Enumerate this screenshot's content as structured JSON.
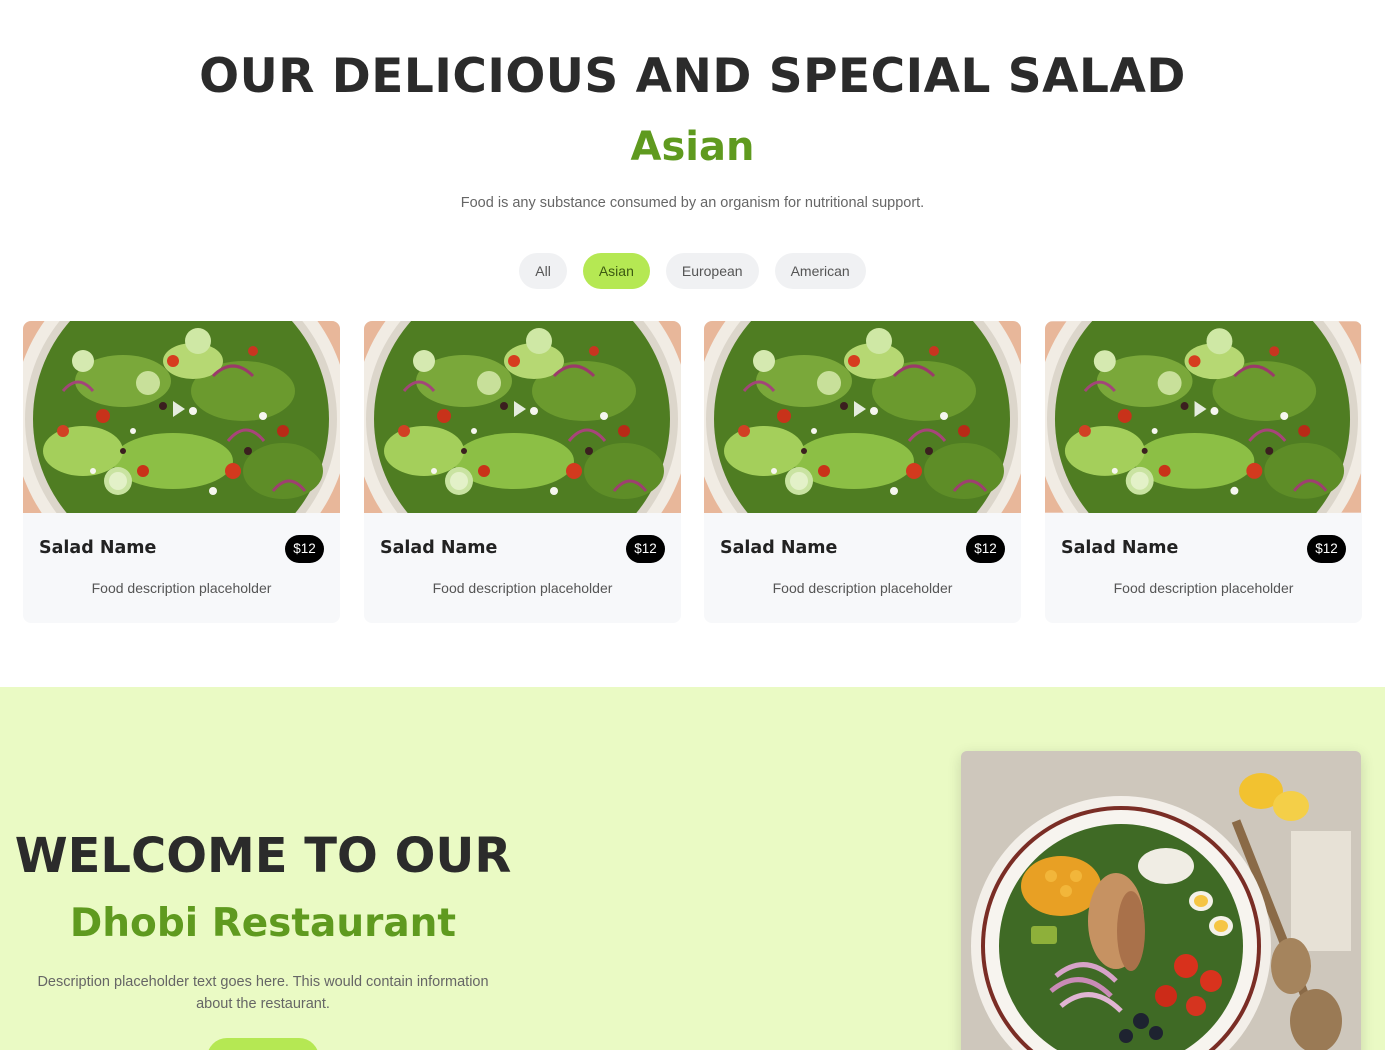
{
  "menu": {
    "title": "OUR DELICIOUS AND SPECIAL SALAD",
    "active_category": "Asian",
    "tagline": "Food is any substance consumed by an organism for nutritional support.",
    "filters": [
      {
        "label": "All",
        "active": false
      },
      {
        "label": "Asian",
        "active": true
      },
      {
        "label": "European",
        "active": false
      },
      {
        "label": "American",
        "active": false
      }
    ],
    "items": [
      {
        "name": "Salad Name",
        "price": "$12",
        "description": "Food description placeholder",
        "image": "salad-bowl-image"
      },
      {
        "name": "Salad Name",
        "price": "$12",
        "description": "Food description placeholder",
        "image": "salad-bowl-image"
      },
      {
        "name": "Salad Name",
        "price": "$12",
        "description": "Food description placeholder",
        "image": "salad-bowl-image"
      },
      {
        "name": "Salad Name",
        "price": "$12",
        "description": "Food description placeholder",
        "image": "salad-bowl-image"
      }
    ]
  },
  "welcome": {
    "title": "WELCOME TO OUR",
    "restaurant_name": "Dhobi Restaurant",
    "description": "Description placeholder text goes here. This would contain information about the restaurant.",
    "image": "cobb-salad-image"
  },
  "colors": {
    "accent_green": "#b5e853",
    "heading_green": "#5f9a1f",
    "welcome_bg": "#eafac4",
    "card_bg": "#f7f8fa",
    "price_badge": "#000000"
  }
}
